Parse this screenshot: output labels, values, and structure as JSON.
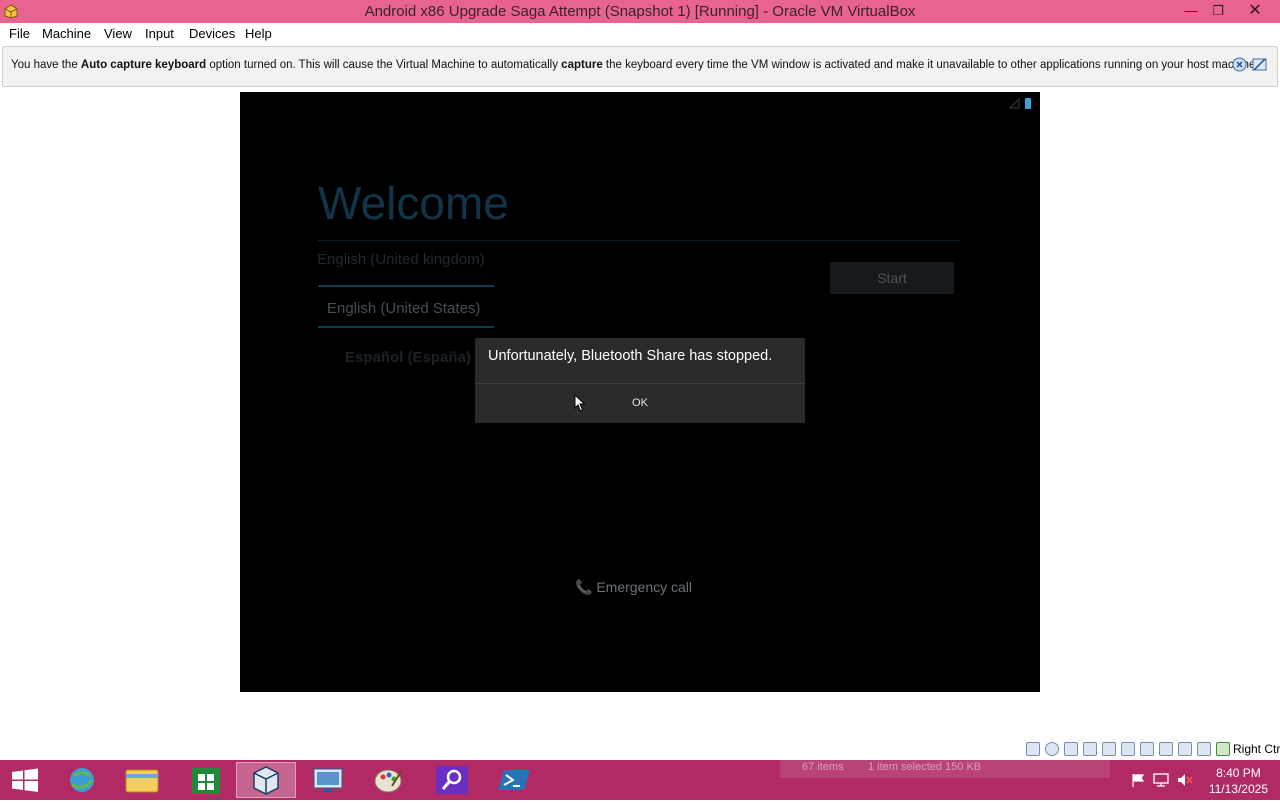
{
  "window": {
    "title": "Android x86 Upgrade Saga Attempt (Snapshot 1) [Running] - Oracle VM VirtualBox",
    "minimize": "—",
    "restore": "❐",
    "close": "✕"
  },
  "menu": [
    "File",
    "Machine",
    "View",
    "Input",
    "Devices",
    "Help"
  ],
  "notice": {
    "p1": "You have the ",
    "b1": "Auto capture keyboard",
    "p2": " option turned on. This will cause the Virtual Machine to automatically ",
    "b2": "capture",
    "p3": " the keyboard every time the VM window is activated and make it unavailable to other applications running on your host machine:"
  },
  "android": {
    "welcome": "Welcome",
    "languages": [
      "English (United kingdom)",
      "English (United States)",
      "Español (España)"
    ],
    "start": "Start",
    "emergency": "Emergency call"
  },
  "dialog": {
    "message": "Unfortunately, Bluetooth Share has stopped.",
    "ok": "OK"
  },
  "statusbar": {
    "host_key": "Right Ctrl"
  },
  "taskbar": {
    "ghost_items": "67 items",
    "ghost_selected": "1 item selected  150 KB",
    "time": "8:40 PM",
    "date": "11/13/2025"
  },
  "colors": {
    "titlebar": "#e8638f",
    "taskbar": "#b12a64",
    "welcome_text": "#12344a",
    "dialog_bg": "#2b2b2b"
  },
  "icons": [
    "virtualbox-app-icon",
    "ie-icon",
    "file-explorer-icon",
    "store-icon",
    "virtualbox-icon",
    "remote-desktop-icon",
    "paint-icon",
    "search-app-icon",
    "powershell-icon"
  ]
}
